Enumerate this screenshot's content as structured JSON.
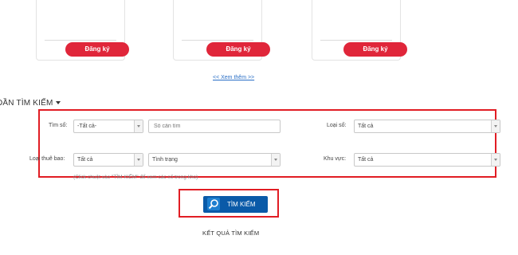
{
  "cards": [
    {
      "register_label": "Đăng ký"
    },
    {
      "register_label": "Đăng ký"
    },
    {
      "register_label": "Đăng ký"
    }
  ],
  "more_link": "<< Xem thêm >>",
  "search_section": {
    "heading": "ĐẦN TÌM KIẾM",
    "so_label": "Tìm số:",
    "so_prefix_value": "-Tất cả-",
    "so_input_placeholder": "Số cần tìm",
    "loai_so_label": "Loại số:",
    "loai_so_value": "Tất cả",
    "loai_thue_bao_label": "Loại thuê bao:",
    "loai_thue_bao_value": "Tất cả",
    "tinh_trang_value": "Tình trạng",
    "khu_vuc_label": "Khu vực:",
    "khu_vuc_value": "Tất cả",
    "hint": "(Click chuột vào \"TÌM KIẾM\" để xem các số trong kho)",
    "search_button_label": "TÌM KIẾM"
  },
  "results_heading": "KẾT QUẢ TÌM KIẾM",
  "colors": {
    "accent_red": "#e0263a",
    "highlight_red": "#e11d24",
    "button_blue": "#0a5aa8",
    "link_blue": "#2a6fc6"
  }
}
